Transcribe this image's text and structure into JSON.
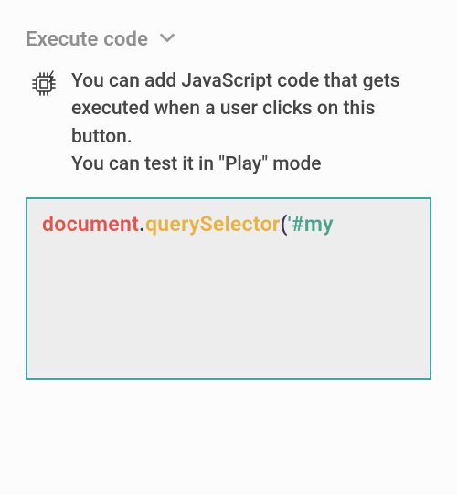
{
  "section": {
    "title": "Execute code"
  },
  "hint": {
    "line1": "You can add JavaScript code that gets executed when a user clicks on this button.",
    "line2": "You can test it in \"Play\" mode"
  },
  "code": {
    "tokens": {
      "ident": "document",
      "dot": ".",
      "method": "querySelector",
      "paren": "(",
      "str": "'#my"
    }
  },
  "icons": {
    "chevron": "chevron-down-icon",
    "cpu": "cpu-bolt-icon"
  }
}
